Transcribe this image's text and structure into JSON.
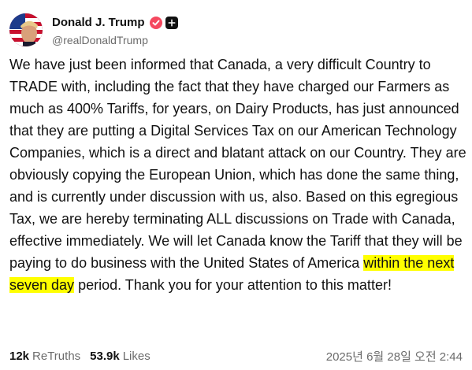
{
  "post": {
    "author": {
      "display_name": "Donald J. Trump",
      "handle": "@realDonaldTrump",
      "verified_icon": "verified-check-icon",
      "follow_icon": "plus-icon",
      "badge_color": "#f5485f"
    },
    "body": {
      "before_highlight": "We have just been informed that Canada, a very difficult Country to TRADE with, including the fact that they have charged our Farmers as much as 400% Tariffs, for years, on Dairy Products, has just announced that they are putting a Digital Services Tax on our American Technology Companies, which is a direct and blatant attack on our Country. They are obviously copying the European Union, which has done the same thing, and is currently under discussion with us, also. Based on this egregious Tax, we are hereby terminating ALL discussions on Trade with Canada, effective immediately. We will let Canada know the Tariff that they will be paying to do business with the United States of America ",
      "highlight": "within the next seven day",
      "after_highlight": " period. Thank you for your attention to this matter!",
      "highlight_color": "#ffff00"
    },
    "stats": {
      "retruths_count": "12k",
      "retruths_label": "ReTruths",
      "likes_count": "53.9k",
      "likes_label": "Likes"
    },
    "timestamp": "2025년 6월 28일 오전 2:44"
  }
}
